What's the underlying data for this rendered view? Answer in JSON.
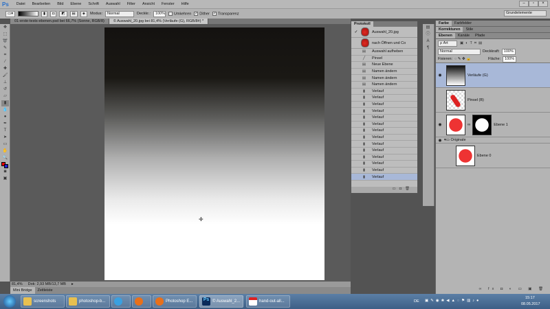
{
  "app": {
    "logo": "Ps"
  },
  "menu": [
    "Datei",
    "Bearbeiten",
    "Bild",
    "Ebene",
    "Schrift",
    "Auswahl",
    "Filter",
    "Ansicht",
    "Fenster",
    "Hilfe"
  ],
  "options": {
    "modus_label": "Modus:",
    "modus_value": "Normal",
    "deckkraft_label": "Deckkr.:",
    "deckkraft_value": "100%",
    "umkehren": "Umkehren",
    "dither": "Dither",
    "transparenz": "Transparenz",
    "workspace": "Grundelemente"
  },
  "doc_tabs": [
    "01-erste-tests-ebenen.psd bei 66,7% (Sonne, RGB/8)",
    "© Auswahl_20.jpg bei 81,4% (Verläufe (G), RGB/8#) *"
  ],
  "status": {
    "zoom": "81,4%",
    "doc_info": "Dok: 2,93 MB/13,7 MB"
  },
  "bottom_tabs": [
    "Mini Bridge",
    "Zeitleiste"
  ],
  "history": {
    "title": "Protokoll",
    "snapshots": [
      "Auswahl_20.jpg",
      "nach Öffnen und Co"
    ],
    "items": [
      "Auswahl aufheben",
      "Pinsel",
      "Neue Ebene",
      "Namen ändern",
      "Namen ändern",
      "Namen ändern",
      "Verlauf",
      "Verlauf",
      "Verlauf",
      "Verlauf",
      "Verlauf",
      "Verlauf",
      "Verlauf",
      "Verlauf",
      "Verlauf",
      "Verlauf",
      "Verlauf",
      "Verlauf",
      "Verlauf",
      "Verlauf"
    ]
  },
  "panels": {
    "row1": [
      "Farbe",
      "Farbfelder"
    ],
    "row2": [
      "Korrekturen",
      "Stile"
    ],
    "row3": [
      "Ebenen",
      "Kanäle",
      "Pfade"
    ],
    "filter": "ρ Art",
    "blend": "Normal",
    "opacity_label": "Deckkraft:",
    "opacity": "100%",
    "lock_label": "Fixieren:",
    "fill_label": "Fläche:",
    "fill": "100%"
  },
  "layers": [
    {
      "name": "Verläufe (G)"
    },
    {
      "name": "Pinsel (B)"
    },
    {
      "name": "Ebene 1"
    },
    {
      "name": "Originale"
    },
    {
      "name": "Ebene 0"
    }
  ],
  "taskbar": {
    "items": [
      "screenshots",
      "photoshop-b...",
      "Photoshop E...",
      "© Auswahl_2...",
      "hand-out-all..."
    ],
    "lang": "DE",
    "time": "15:17",
    "date": "08.05.2017"
  }
}
